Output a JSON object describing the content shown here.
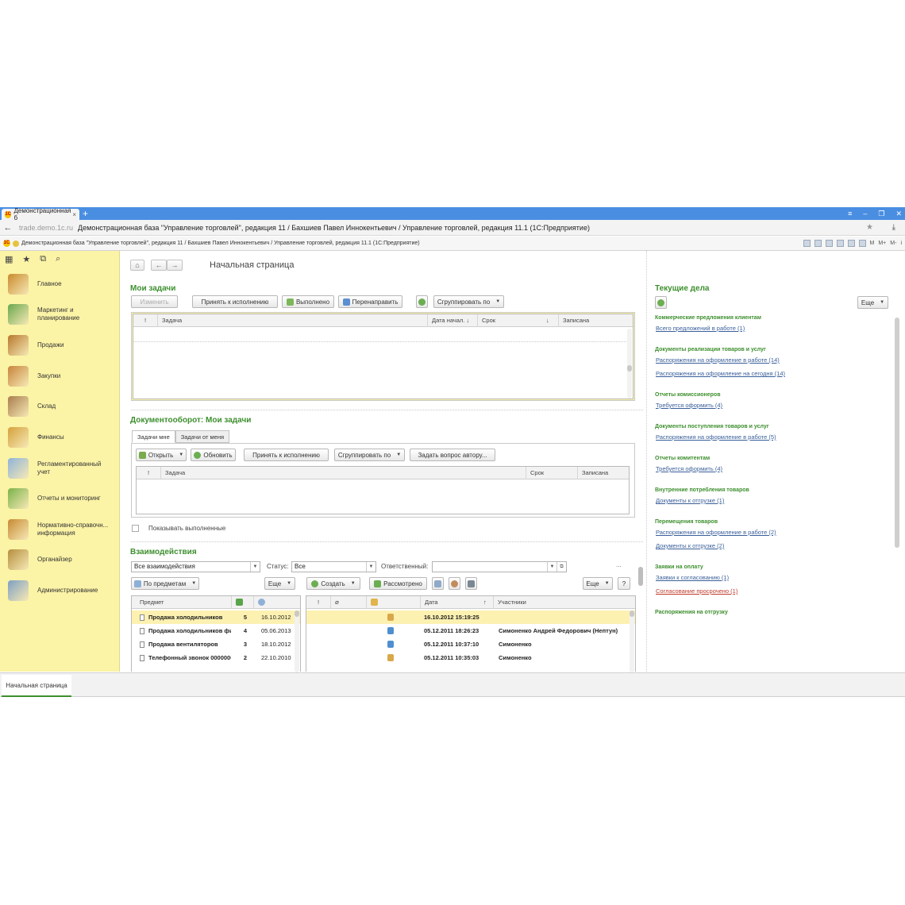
{
  "browser": {
    "tab_title": "Демонстрационная б",
    "tab_close": "×",
    "new_tab": "+",
    "url_host": "trade.demo.1c.ru",
    "url_title": "Демонстрационная база \"Управление торговлей\", редакция 11 / Бахшиев Павел Иннокентьевич / Управление торговлей, редакция 11.1 (1С:Предприятие)",
    "win_menu": "≡",
    "win_min": "–",
    "win_restore": "❐",
    "win_close": "✕"
  },
  "app": {
    "caption": "Демонстрационная база \"Управление торговлей\", редакция 11 / Бахшиев Павел Иннокентьевич / Управление торговлей, редакция 11.1  (1С:Предприятие)",
    "caption_right": [
      "M",
      "M+",
      "M-",
      "i"
    ]
  },
  "sidebar": {
    "items": [
      {
        "label": "Главное",
        "icon": "home-icon",
        "color": "#c98a2c"
      },
      {
        "label": "Маркетинг и планирование",
        "icon": "marketing-icon",
        "color": "#6aa84f"
      },
      {
        "label": "Продажи",
        "icon": "sales-icon",
        "color": "#b7782d"
      },
      {
        "label": "Закупки",
        "icon": "purchases-icon",
        "color": "#c7843a"
      },
      {
        "label": "Склад",
        "icon": "warehouse-icon",
        "color": "#a97d4d"
      },
      {
        "label": "Финансы",
        "icon": "finance-icon",
        "color": "#d5a13c"
      },
      {
        "label": "Регламентированный учет",
        "icon": "accounting-icon",
        "color": "#8fb3d9"
      },
      {
        "label": "Отчеты и мониторинг",
        "icon": "reports-icon",
        "color": "#7ab24a"
      },
      {
        "label": "Нормативно-справочн... информация",
        "icon": "reference-icon",
        "color": "#c78a33"
      },
      {
        "label": "Органайзер",
        "icon": "organizer-icon",
        "color": "#b58e3e"
      },
      {
        "label": "Администрирование",
        "icon": "admin-icon",
        "color": "#7f9fc4"
      }
    ]
  },
  "main": {
    "page_title": "Начальная страница",
    "my_tasks": {
      "title": "Мои задачи",
      "buttons": {
        "edit": "Изменить",
        "accept": "Принять к исполнению",
        "done": "Выполнено",
        "redirect": "Перенаправить",
        "group": "Сгруппировать по"
      },
      "columns": [
        "!",
        "Задача",
        "Дата начал. ↓",
        "Срок",
        "↓",
        "Записана"
      ]
    },
    "doc_tasks": {
      "title": "Документооборот: Мои задачи",
      "tabs": [
        "Задачи мне",
        "Задачи от меня"
      ],
      "buttons": {
        "open": "Открыть",
        "refresh": "Обновить",
        "accept": "Принять к исполнению",
        "group": "Сгруппировать по",
        "ask": "Задать вопрос автору..."
      },
      "columns": [
        "!",
        "Задача",
        "Срок",
        "Записана"
      ],
      "show_done": "Показывать выполненные"
    },
    "interactions": {
      "title": "Взаимодействия",
      "filter_value": "Все взаимодействия",
      "status_label": "Статус:",
      "status_value": "Все",
      "responsible_label": "Ответственный:",
      "responsible_value": "",
      "by_subject": "По предметам",
      "more": "Еще",
      "create": "Создать",
      "reviewed": "Рассмотрено",
      "left_columns": [
        "Предмет",
        "",
        ""
      ],
      "left_rows": [
        {
          "subject": "Продажа холодильников",
          "count": "5",
          "date": "16.10.2012",
          "selected": true
        },
        {
          "subject": "Продажа холодильников фирь",
          "count": "4",
          "date": "05.06.2013",
          "selected": false
        },
        {
          "subject": "Продажа вентиляторов",
          "count": "3",
          "date": "18.10.2012",
          "selected": false
        },
        {
          "subject": "Телефонный звонок 00000000(",
          "count": "2",
          "date": "22.10.2010",
          "selected": false
        }
      ],
      "right_columns": [
        "!",
        "",
        "",
        "Дата",
        "↑",
        "Участники"
      ],
      "right_rows": [
        {
          "date": "16.10.2012 15:19:25",
          "participants": "",
          "type": "meeting-icon",
          "selected": true
        },
        {
          "date": "05.12.2011 18:26:23",
          "participants": "Симоненко Андрей Федорович (Нептун)",
          "type": "phone-icon",
          "selected": false
        },
        {
          "date": "05.12.2011 10:37:10",
          "participants": "Симоненко",
          "type": "phone-icon",
          "selected": false
        },
        {
          "date": "05.12.2011 10:35:03",
          "participants": "Симоненко",
          "type": "meeting-icon",
          "selected": false
        }
      ]
    }
  },
  "current_tasks": {
    "title": "Текущие дела",
    "more": "Еще",
    "groups": [
      {
        "title": "Коммерческие предложения клиентам",
        "links": [
          {
            "text": "Всего предложений в работе (1)",
            "alert": false
          }
        ]
      },
      {
        "title": "Документы реализации товаров и услуг",
        "links": [
          {
            "text": "Распоряжения на оформление в работе (14)",
            "alert": false
          },
          {
            "text": "Распоряжения на оформление на сегодня (14)",
            "alert": false
          }
        ]
      },
      {
        "title": "Отчеты комиссионеров",
        "links": [
          {
            "text": "Требуется оформить (4)",
            "alert": false
          }
        ]
      },
      {
        "title": "Документы поступления товаров и услуг",
        "links": [
          {
            "text": "Распоряжения на оформление в работе (5)",
            "alert": false
          }
        ]
      },
      {
        "title": "Отчеты комитентам",
        "links": [
          {
            "text": "Требуется оформить (4)",
            "alert": false
          }
        ]
      },
      {
        "title": "Внутренние потребления товаров",
        "links": [
          {
            "text": "Документы к отгрузке (1)",
            "alert": false
          }
        ]
      },
      {
        "title": "Перемещения товаров",
        "links": [
          {
            "text": "Распоряжения на оформление в работе (2)",
            "alert": false
          },
          {
            "text": "Документы к отгрузке (2)",
            "alert": false
          }
        ]
      },
      {
        "title": "Заявки на оплату",
        "links": [
          {
            "text": "Заявки к согласованию (1)",
            "alert": false
          },
          {
            "text": "Согласование просрочено (1)",
            "alert": true
          }
        ]
      },
      {
        "title": "Распоряжения на отгрузку",
        "links": []
      }
    ]
  },
  "bottom": {
    "tab": "Начальная страница"
  }
}
